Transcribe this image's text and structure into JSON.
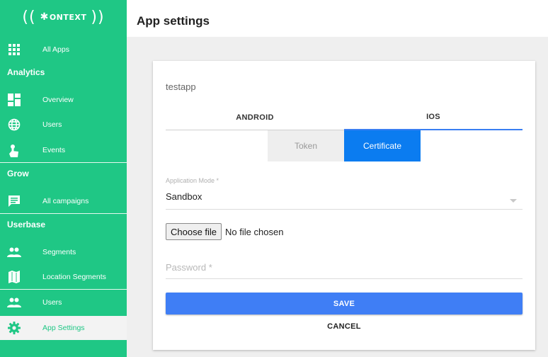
{
  "logo": {
    "left_paren": "((",
    "brand": "ONTEXT",
    "right_paren": "))"
  },
  "sidebar": {
    "all_apps": "All Apps",
    "sections": {
      "analytics": "Analytics",
      "grow": "Grow",
      "userbase": "Userbase"
    },
    "items": {
      "overview": "Overview",
      "users": "Users",
      "events": "Events",
      "all_campaigns": "All campaigns",
      "segments": "Segments",
      "location_segments": "Location Segments",
      "users2": "Users",
      "app_settings": "App Settings"
    }
  },
  "header": {
    "title": "App settings"
  },
  "card": {
    "app_name": "testapp",
    "tabs": {
      "android": "ANDROID",
      "ios": "IOS"
    },
    "subtabs": {
      "token": "Token",
      "certificate": "Certificate"
    },
    "mode": {
      "label": "Application Mode *",
      "value": "Sandbox"
    },
    "file": {
      "button": "Choose file",
      "status": "No file chosen"
    },
    "password": {
      "placeholder": "Password *"
    },
    "save_label": "SAVE",
    "cancel_label": "CANCEL"
  },
  "colors": {
    "sidebar": "#1fc785",
    "accent": "#3f7ef5",
    "active_subtab": "#0b7cf0"
  }
}
